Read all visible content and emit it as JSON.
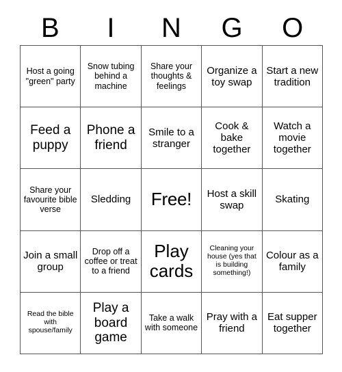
{
  "header": {
    "letters": [
      "B",
      "I",
      "N",
      "G",
      "O"
    ]
  },
  "grid": {
    "rows": 5,
    "columns": 5,
    "border_color": "#555555",
    "background_color": "#ffffff",
    "text_color": "#000000",
    "cells": [
      {
        "text": "Host a going \"green\" party",
        "size": "fs-sm"
      },
      {
        "text": "Snow tubing behind a machine",
        "size": "fs-sm"
      },
      {
        "text": "Share your thoughts & feelings",
        "size": "fs-sm"
      },
      {
        "text": "Organize a toy swap",
        "size": "fs-md"
      },
      {
        "text": "Start a new tradition",
        "size": "fs-md"
      },
      {
        "text": "Feed a puppy",
        "size": "fs-lg"
      },
      {
        "text": "Phone a friend",
        "size": "fs-lg"
      },
      {
        "text": "Smile to a stranger",
        "size": "fs-md"
      },
      {
        "text": "Cook & bake together",
        "size": "fs-md"
      },
      {
        "text": "Watch a movie together",
        "size": "fs-md"
      },
      {
        "text": "Share your favourite bible verse",
        "size": "fs-sm"
      },
      {
        "text": "Sledding",
        "size": "fs-md"
      },
      {
        "text": "Free!",
        "size": "fs-xl"
      },
      {
        "text": "Host a skill swap",
        "size": "fs-md"
      },
      {
        "text": "Skating",
        "size": "fs-md"
      },
      {
        "text": "Join a small group",
        "size": "fs-md"
      },
      {
        "text": "Drop off a coffee or treat to a friend",
        "size": "fs-sm"
      },
      {
        "text": "Play cards",
        "size": "fs-xl"
      },
      {
        "text": "Cleaning your house (yes that is building something!)",
        "size": "fs-xs"
      },
      {
        "text": "Colour as a family",
        "size": "fs-md"
      },
      {
        "text": "Read the bible with spouse/family",
        "size": "fs-xs"
      },
      {
        "text": "Play a board game",
        "size": "fs-lg"
      },
      {
        "text": "Take a walk with someone",
        "size": "fs-sm"
      },
      {
        "text": "Pray with a friend",
        "size": "fs-md"
      },
      {
        "text": "Eat supper together",
        "size": "fs-md"
      }
    ]
  }
}
